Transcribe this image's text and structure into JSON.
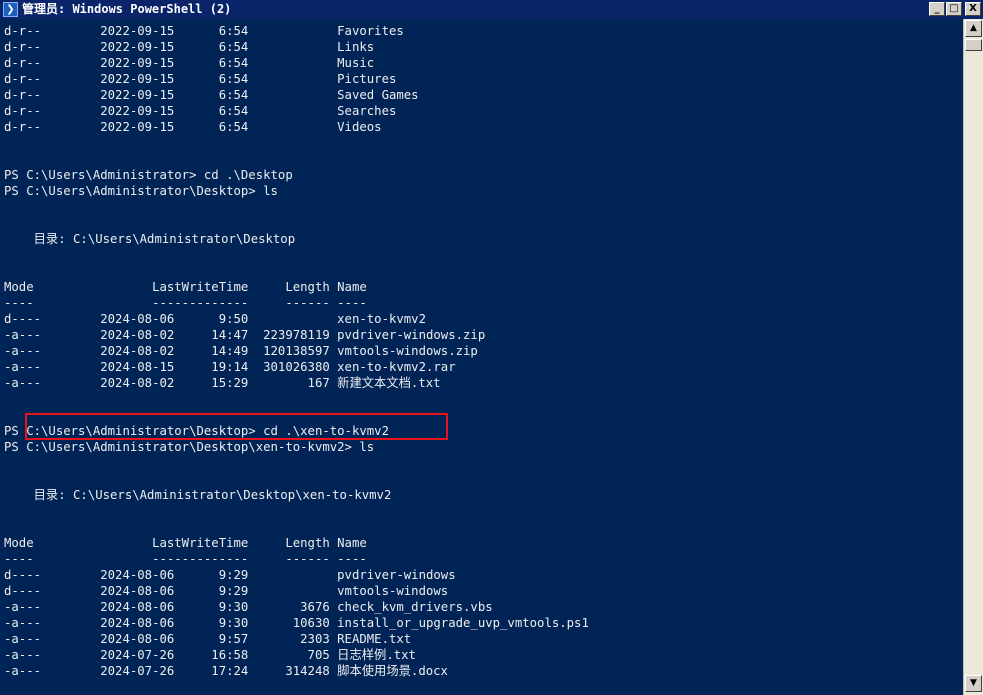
{
  "window": {
    "title": "管理员: Windows PowerShell (2)",
    "icon": "powershell-icon",
    "minimize_label": "_",
    "maximize_label": "□",
    "close_label": "X"
  },
  "colors": {
    "console_background": "#012456",
    "console_text": "#eeedf0",
    "highlight_border": "#e8141a"
  },
  "console_lines": [
    "d-r--        2022-09-15      6:54            Favorites",
    "d-r--        2022-09-15      6:54            Links",
    "d-r--        2022-09-15      6:54            Music",
    "d-r--        2022-09-15      6:54            Pictures",
    "d-r--        2022-09-15      6:54            Saved Games",
    "d-r--        2022-09-15      6:54            Searches",
    "d-r--        2022-09-15      6:54            Videos",
    "",
    "",
    "PS C:\\Users\\Administrator> cd .\\Desktop",
    "PS C:\\Users\\Administrator\\Desktop> ls",
    "",
    "",
    "    目录: C:\\Users\\Administrator\\Desktop",
    "",
    "",
    "Mode                LastWriteTime     Length Name",
    "----                -------------     ------ ----",
    "d----        2024-08-06      9:50            xen-to-kvmv2",
    "-a---        2024-08-02     14:47  223978119 pvdriver-windows.zip",
    "-a---        2024-08-02     14:49  120138597 vmtools-windows.zip",
    "-a---        2024-08-15     19:14  301026380 xen-to-kvmv2.rar",
    "-a---        2024-08-02     15:29        167 新建文本文档.txt",
    "",
    "",
    "PS C:\\Users\\Administrator\\Desktop> cd .\\xen-to-kvmv2",
    "PS C:\\Users\\Administrator\\Desktop\\xen-to-kvmv2> ls",
    "",
    "",
    "    目录: C:\\Users\\Administrator\\Desktop\\xen-to-kvmv2",
    "",
    "",
    "Mode                LastWriteTime     Length Name",
    "----                -------------     ------ ----",
    "d----        2024-08-06      9:29            pvdriver-windows",
    "d----        2024-08-06      9:29            vmtools-windows",
    "-a---        2024-08-06      9:30       3676 check_kvm_drivers.vbs",
    "-a---        2024-08-06      9:30      10630 install_or_upgrade_uvp_vmtools.ps1",
    "-a---        2024-08-06      9:57       2303 README.txt",
    "-a---        2024-07-26     16:58        705 日志样例.txt",
    "-a---        2024-07-26     17:24     314248 脚本使用场景.docx"
  ],
  "scrollbar": {
    "up_arrow_icon": "up-arrow-icon",
    "down_arrow_icon": "down-arrow-icon"
  }
}
